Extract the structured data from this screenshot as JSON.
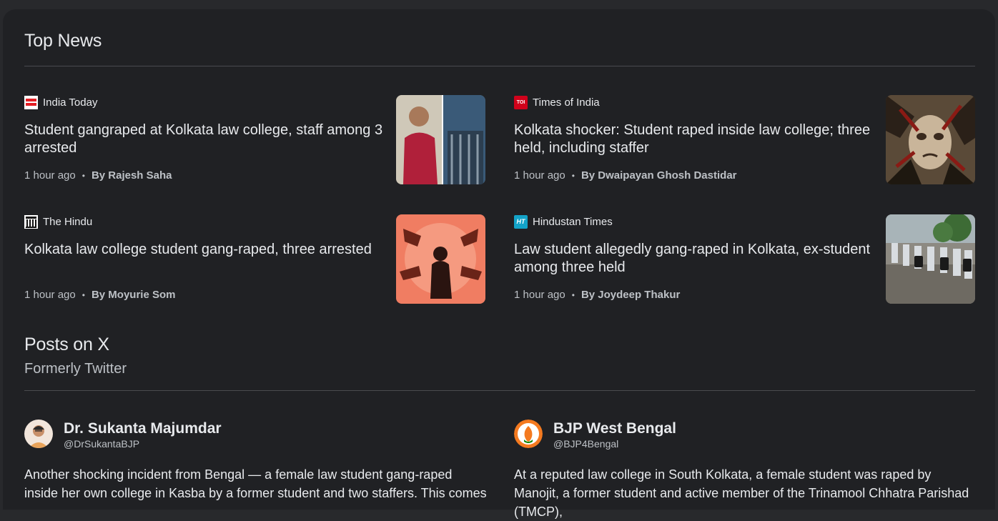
{
  "top_news": {
    "title": "Top News",
    "articles": [
      {
        "source": "India Today",
        "headline": "Student gangraped at Kolkata law college, staff among 3 arrested",
        "time": "1 hour ago",
        "author": "By Rajesh Saha",
        "logo_icon": "india-today-logo-icon"
      },
      {
        "source": "Times of India",
        "headline": "Kolkata shocker: Student raped inside law college; three held, including staffer",
        "time": "1 hour ago",
        "author": "By Dwaipayan Ghosh Dastidar",
        "logo_icon": "times-of-india-logo-icon"
      },
      {
        "source": "The Hindu",
        "headline": "Kolkata law college student gang-raped, three arrested",
        "time": "1 hour ago",
        "author": "By Moyurie Som",
        "logo_icon": "the-hindu-logo-icon"
      },
      {
        "source": "Hindustan Times",
        "headline": "Law student allegedly gang-raped in Kolkata, ex-student among three held",
        "time": "1 hour ago",
        "author": "By Joydeep Thakur",
        "logo_icon": "hindustan-times-logo-icon"
      }
    ]
  },
  "posts_on_x": {
    "title": "Posts on X",
    "subtitle": "Formerly Twitter",
    "posts": [
      {
        "name": "Dr. Sukanta Majumdar",
        "handle": "@DrSukantaBJP",
        "text": "Another shocking incident from Bengal — a female law student gang-raped inside her own college in Kasba by a former student and two staffers. This comes"
      },
      {
        "name": "BJP West Bengal",
        "handle": "@BJP4Bengal",
        "text": "At a reputed law college in South Kolkata, a female student was raped by Manojit, a former student and active member of the Trinamool Chhatra Parishad (TMCP),"
      }
    ]
  },
  "colors": {
    "background": "#202124",
    "text_primary": "#e8eaed",
    "text_secondary": "#bdc1c6",
    "divider": "#4a4b4f"
  }
}
